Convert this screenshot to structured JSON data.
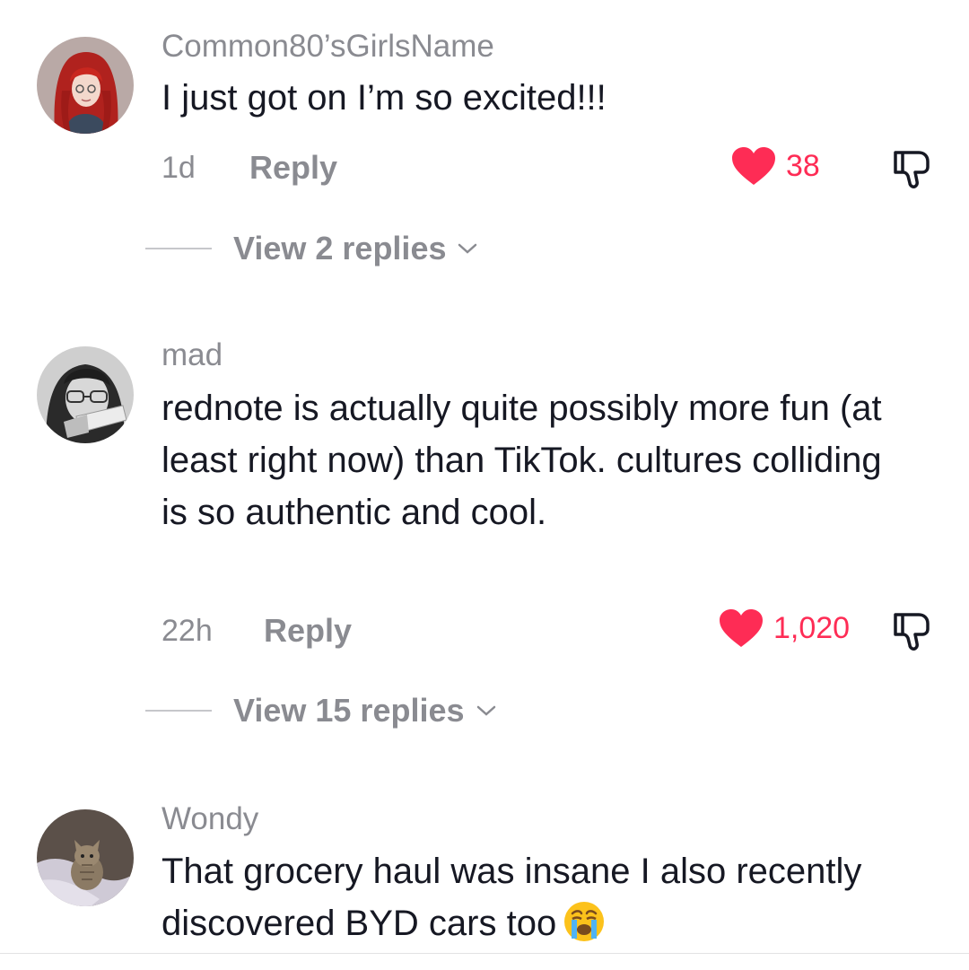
{
  "comments": [
    {
      "username": "Common80’sGirlsName",
      "text": "I just got on I’m so excited!!!",
      "time": "1d",
      "reply_label": "Reply",
      "likes": "38",
      "liked": true,
      "view_replies": "View 2 replies",
      "avatar_icon": "red-hair-avatar"
    },
    {
      "username": "mad",
      "text": "rednote is actually quite possibly more fun (at least right now) than TikTok. cultures colliding is so authentic and cool.",
      "time": "22h",
      "reply_label": "Reply",
      "likes": "1,020",
      "liked": true,
      "view_replies": "View 15 replies",
      "avatar_icon": "grayscale-glasses-avatar"
    },
    {
      "username": "Wondy",
      "text": "That grocery haul was insane I also recently discovered BYD cars too",
      "emoji": "loudly-crying-face",
      "avatar_icon": "kitten-avatar"
    }
  ],
  "colors": {
    "like_red": "#fe2c55",
    "meta_gray": "#8a8b91",
    "text_dark": "#161823"
  }
}
